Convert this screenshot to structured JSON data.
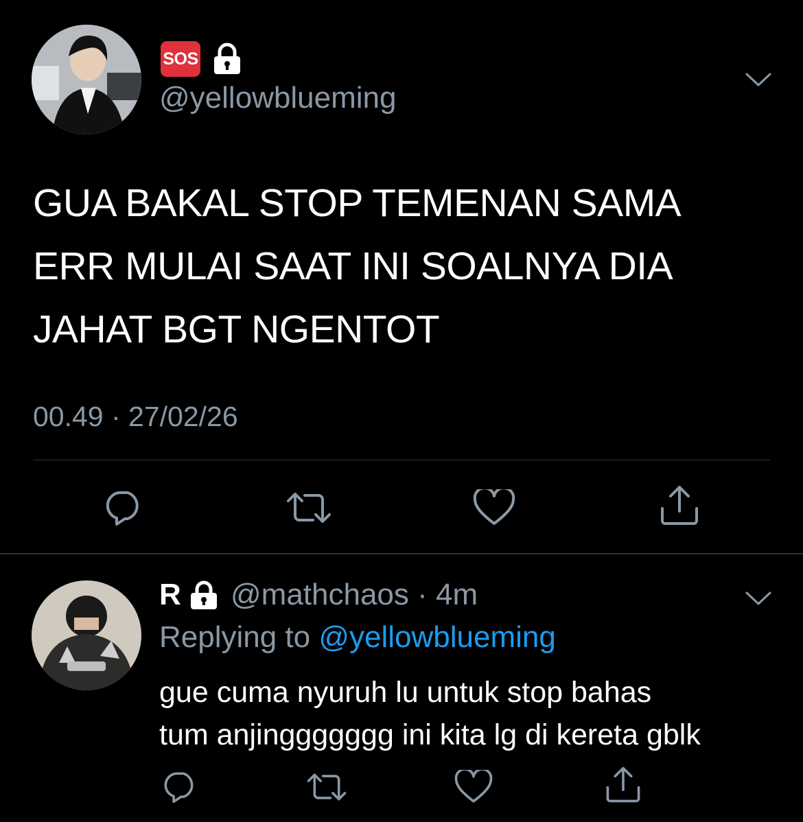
{
  "main_tweet": {
    "badge_text": "SOS",
    "handle": "@yellowblueming",
    "text": "GUA BAKAL STOP TEMENAN SAMA\nERR MULAI SAAT INI SOALNYA DIA\nJAHAT BGT NGENTOT",
    "time": "00.49 · 27/02/26",
    "icons": {
      "avatar": "profile-photo-icon",
      "badge": "sos-emoji-icon",
      "lock": "lock-icon",
      "menu": "chevron-down-icon",
      "actions": [
        "reply-icon",
        "retweet-icon",
        "like-icon",
        "share-icon"
      ]
    }
  },
  "reply_tweet": {
    "name": "R",
    "handle_time": "@mathchaos · 4m",
    "replying_prefix": "Replying to ",
    "replying_mention": "@yellowblueming",
    "text": "gue cuma nyuruh lu untuk stop bahas\ntum anjinggggggg ini kita lg di kereta gblk",
    "icons": {
      "avatar": "profile-photo-icon",
      "lock": "lock-icon",
      "menu": "chevron-down-icon",
      "actions": [
        "reply-icon",
        "retweet-icon",
        "like-icon",
        "share-icon"
      ]
    }
  },
  "colors": {
    "background": "#000000",
    "primary_text": "#ffffff",
    "secondary_text": "#8b98a5",
    "link": "#1d9bf0",
    "divider": "#2f3336",
    "sos_badge": "#e0313c"
  }
}
